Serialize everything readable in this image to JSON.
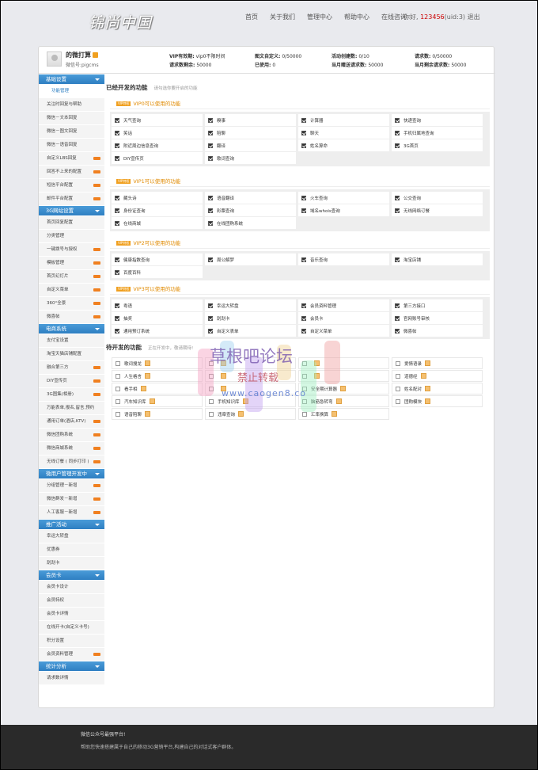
{
  "header": {
    "logo_text": "锦尚中国",
    "nav": [
      "首页",
      "关于我们",
      "管理中心",
      "帮助中心",
      "在线咨询"
    ],
    "greeting": "你好,",
    "username": "123456",
    "uid": "(uid:3)",
    "logout": "退出"
  },
  "profile": {
    "name": "的微打算",
    "wechat_id": "微信号:pigcms",
    "stats": [
      {
        "label": "VIP有效期:",
        "value": "vip0不限时间"
      },
      {
        "label": "图文自定义:",
        "value": "0/50000"
      },
      {
        "label": "活动创建数:",
        "value": "0/10"
      },
      {
        "label": "请求数:",
        "value": "0/50000"
      },
      {
        "label": "请求数剩余:",
        "value": "50000"
      },
      {
        "label": "已使用:",
        "value": "0"
      },
      {
        "label": "当月赠送请求数:",
        "value": "50000"
      },
      {
        "label": "当月剩余请求数:",
        "value": "50000"
      }
    ]
  },
  "sidebar": [
    {
      "title": "基础设置",
      "items": [
        {
          "label": "功能管理",
          "active": true,
          "new": false
        },
        {
          "label": "关注时回复与帮助",
          "new": false
        },
        {
          "label": "微信－文本回复",
          "new": false
        },
        {
          "label": "微信－图文回复",
          "new": false
        },
        {
          "label": "微信－语音回复",
          "new": false
        },
        {
          "label": "自定义LBS回复",
          "new": true
        },
        {
          "label": "回答不上来的配置",
          "new": true
        },
        {
          "label": "短信平台配置",
          "new": true
        },
        {
          "label": "邮件平台配置",
          "new": true
        }
      ]
    },
    {
      "title": "3G网站设置",
      "items": [
        {
          "label": "首页回复配置",
          "new": false
        },
        {
          "label": "分类管理",
          "new": false
        },
        {
          "label": "一键拨号与授权",
          "new": true
        },
        {
          "label": "模板管理",
          "new": true
        },
        {
          "label": "首页幻灯片",
          "new": true
        },
        {
          "label": "自定义菜单",
          "new": true
        },
        {
          "label": "360°全景",
          "new": true
        },
        {
          "label": "微喜帖",
          "new": true
        }
      ]
    },
    {
      "title": "电商系统",
      "items": [
        {
          "label": "支付宝设置",
          "new": false
        },
        {
          "label": "淘宝天猫店铺配置",
          "new": false
        },
        {
          "label": "融合第三方",
          "new": true
        },
        {
          "label": "DIY宣传页",
          "new": true
        },
        {
          "label": "3G图集(相册)",
          "new": true
        },
        {
          "label": "万能表单,报名,留言,预约",
          "new": false
        },
        {
          "label": "通用订单(酒店,KTV)",
          "new": true
        },
        {
          "label": "微信团购系统",
          "new": true
        },
        {
          "label": "微信商城系统",
          "new": true
        },
        {
          "label": "无线订餐 ( 同步打印 )",
          "new": true
        }
      ]
    },
    {
      "title": "微用户管理开发中",
      "items": [
        {
          "label": "分组管理－新增",
          "new": true
        },
        {
          "label": "微信群发－新增",
          "new": true
        },
        {
          "label": "人工客服－新增",
          "new": true
        }
      ]
    },
    {
      "title": "推广活动",
      "items": [
        {
          "label": "幸运大转盘",
          "new": false
        },
        {
          "label": "优惠券",
          "new": false
        },
        {
          "label": "刮刮卡",
          "new": false
        }
      ]
    },
    {
      "title": "会员卡",
      "items": [
        {
          "label": "会员卡设计",
          "new": false
        },
        {
          "label": "会员特权",
          "new": false
        },
        {
          "label": "会员卡详情",
          "new": false
        },
        {
          "label": "在线开卡(自定义卡号)",
          "new": false
        },
        {
          "label": "积分设置",
          "new": false
        },
        {
          "label": "会员资料管理",
          "new": true
        }
      ]
    },
    {
      "title": "统计分析",
      "items": [
        {
          "label": "请求数详情",
          "new": false
        }
      ]
    }
  ],
  "main": {
    "title": "已经开发的功能",
    "hint": "请勾选你要开启的功能",
    "groups": [
      {
        "tag": "VIP特权",
        "name": "VIP0可以使用的功能",
        "items": [
          "天气查询",
          "糗事",
          "计算器",
          "快递查询",
          "笑话",
          "陪聊",
          "聊天",
          "手机归属地查询",
          "附近周边信息查询",
          "翻译",
          "姓名算命",
          "3G首页",
          "DIY宣传页",
          "歌词查询"
        ]
      },
      {
        "tag": "VIP特权",
        "name": "VIP1可以使用的功能",
        "items": [
          "藏头诗",
          "语音翻译",
          "火车查询",
          "公交查询",
          "身份证查询",
          "彩票查询",
          "域名whois查询",
          "无线网络订餐",
          "在线商城",
          "在线团购系统"
        ]
      },
      {
        "tag": "VIP特权",
        "name": "VIP2可以使用的功能",
        "items": [
          "健康指数查询",
          "周公解梦",
          "音乐查询",
          "淘宝店铺",
          "百度百科"
        ]
      },
      {
        "tag": "VIP特权",
        "name": "VIP3可以使用的功能",
        "items": [
          "粤语",
          "幸运大转盘",
          "会员资料管理",
          "第三方接口",
          "抽奖",
          "刮刮卡",
          "会员卡",
          "官网账号审核",
          "通用预订系统",
          "自定义表单",
          "自定义菜单",
          "微喜帖"
        ]
      }
    ],
    "pending_title": "待开发的功能",
    "pending_hint": "正在开发中，敬请期待!",
    "pending": [
      "歌词搜龙",
      "",
      "",
      "爱情语录",
      "人生格言",
      "",
      "",
      "道德经",
      "看手相",
      "",
      "安全期计算器",
      "姓名配对",
      "汽车知识库",
      "手机知识库",
      "脑筋急转弯",
      "团购模块",
      "语音陪聊",
      "违章查询",
      "汇率换算",
      ""
    ]
  },
  "watermark": {
    "line1": "草根吧论坛",
    "line2": "禁止转载",
    "line3": "www.caogen8.co"
  },
  "footer": {
    "line1": "微信公众号最强平台!",
    "line2": "帮助您快速搭建属于自己的移动3G营销平台,构建自己的对话式客户群体。"
  }
}
